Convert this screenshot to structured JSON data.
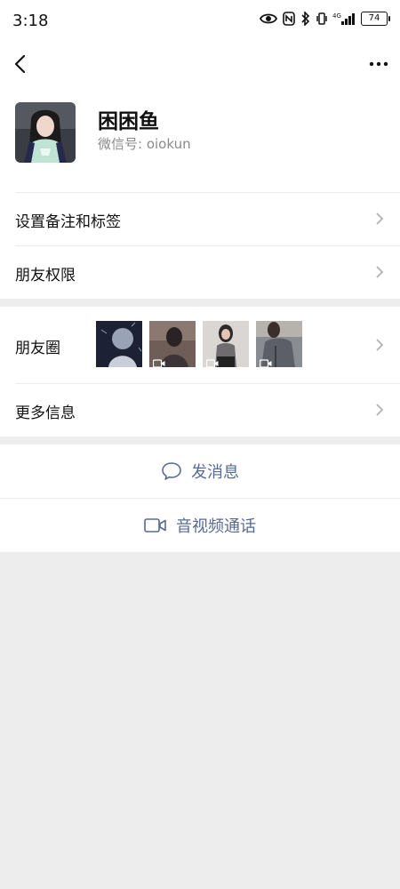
{
  "status_bar": {
    "time": "3:18",
    "battery": "74"
  },
  "profile": {
    "name": "困困鱼",
    "wechat_id": "微信号: oiokun"
  },
  "rows": {
    "remark": "设置备注和标签",
    "permissions": "朋友权限",
    "moments": "朋友圈",
    "more_info": "更多信息"
  },
  "actions": {
    "message": "发消息",
    "av_call": "音视频通话"
  },
  "colors": {
    "link": "#576b95",
    "background": "#ededed"
  }
}
